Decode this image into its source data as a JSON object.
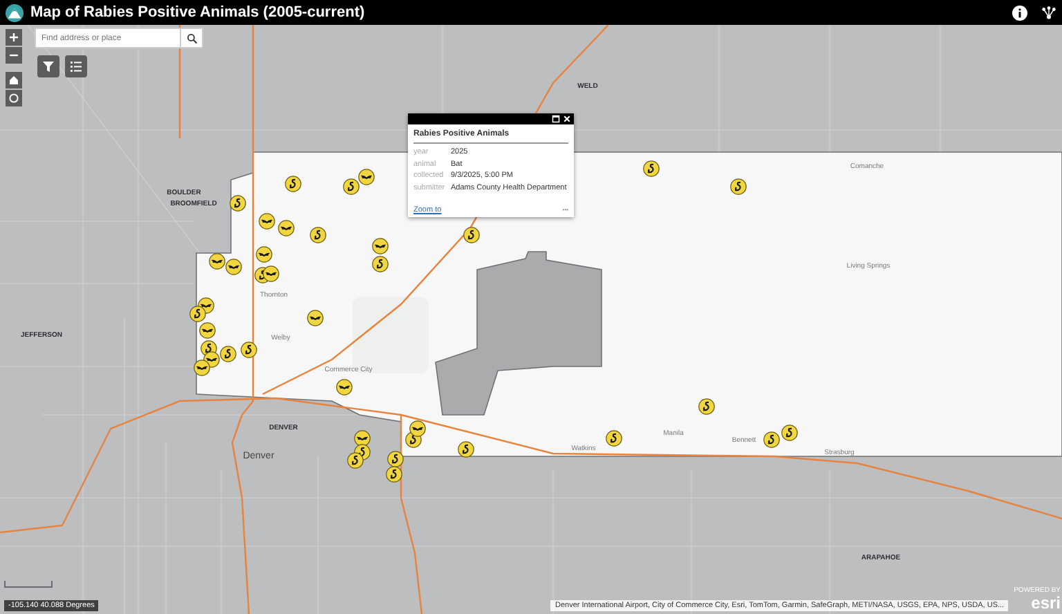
{
  "header": {
    "title": "Map of Rabies Positive Animals (2005-current)"
  },
  "search": {
    "placeholder": "Find address or place"
  },
  "popup": {
    "title": "Rabies Positive Animals",
    "fields": [
      {
        "label": "year",
        "value": "2025"
      },
      {
        "label": "animal",
        "value": "Bat"
      },
      {
        "label": "collected",
        "value": "9/3/2025, 5:00 PM"
      },
      {
        "label": "submitter",
        "value": "Adams County Health Department"
      }
    ],
    "zoom_link": "Zoom to",
    "menu": "•••"
  },
  "map_labels": [
    {
      "text": "WELD",
      "kind": "county"
    },
    {
      "text": "BOULDER",
      "kind": "county"
    },
    {
      "text": "BROOMFIELD",
      "kind": "county"
    },
    {
      "text": "JEFFERSON",
      "kind": "county"
    },
    {
      "text": "Thornton",
      "kind": "place"
    },
    {
      "text": "Welby",
      "kind": "place"
    },
    {
      "text": "Commerce City",
      "kind": "place"
    },
    {
      "text": "DENVER",
      "kind": "county"
    },
    {
      "text": "Denver",
      "kind": "city"
    },
    {
      "text": "Comanche",
      "kind": "place"
    },
    {
      "text": "Living Springs",
      "kind": "place"
    },
    {
      "text": "Watkins",
      "kind": "place"
    },
    {
      "text": "Manila",
      "kind": "place"
    },
    {
      "text": "Bennett",
      "kind": "place"
    },
    {
      "text": "Strasburg",
      "kind": "place"
    },
    {
      "text": "ARAPAHOE",
      "kind": "county"
    }
  ],
  "markers": [
    {
      "kind": "other"
    },
    {
      "kind": "bat"
    },
    {
      "kind": "other"
    },
    {
      "kind": "other"
    },
    {
      "kind": "bat"
    },
    {
      "kind": "bat"
    },
    {
      "kind": "other"
    },
    {
      "kind": "bat"
    },
    {
      "kind": "other"
    },
    {
      "kind": "bat"
    },
    {
      "kind": "bat"
    },
    {
      "kind": "bat"
    },
    {
      "kind": "other"
    },
    {
      "kind": "bat"
    },
    {
      "kind": "bat"
    },
    {
      "kind": "other"
    },
    {
      "kind": "bat"
    },
    {
      "kind": "other"
    },
    {
      "kind": "bat"
    },
    {
      "kind": "other"
    },
    {
      "kind": "other"
    },
    {
      "kind": "bat"
    },
    {
      "kind": "bat"
    },
    {
      "kind": "bat"
    },
    {
      "kind": "bat"
    },
    {
      "kind": "other"
    },
    {
      "kind": "other"
    },
    {
      "kind": "other"
    },
    {
      "kind": "bat"
    },
    {
      "kind": "other"
    },
    {
      "kind": "other"
    },
    {
      "kind": "other"
    },
    {
      "kind": "other"
    },
    {
      "kind": "other"
    },
    {
      "kind": "other"
    },
    {
      "kind": "other"
    },
    {
      "kind": "other"
    },
    {
      "kind": "other"
    },
    {
      "kind": "other"
    }
  ],
  "coordinates": "-105.140 40.088 Degrees",
  "attribution": "Denver International Airport, City of Commerce City, Esri, TomTom, Garmin, SafeGraph, METI/NASA, USGS, EPA, NPS, USDA, US...",
  "logo": {
    "caption": "POWERED BY",
    "text": "esri"
  }
}
